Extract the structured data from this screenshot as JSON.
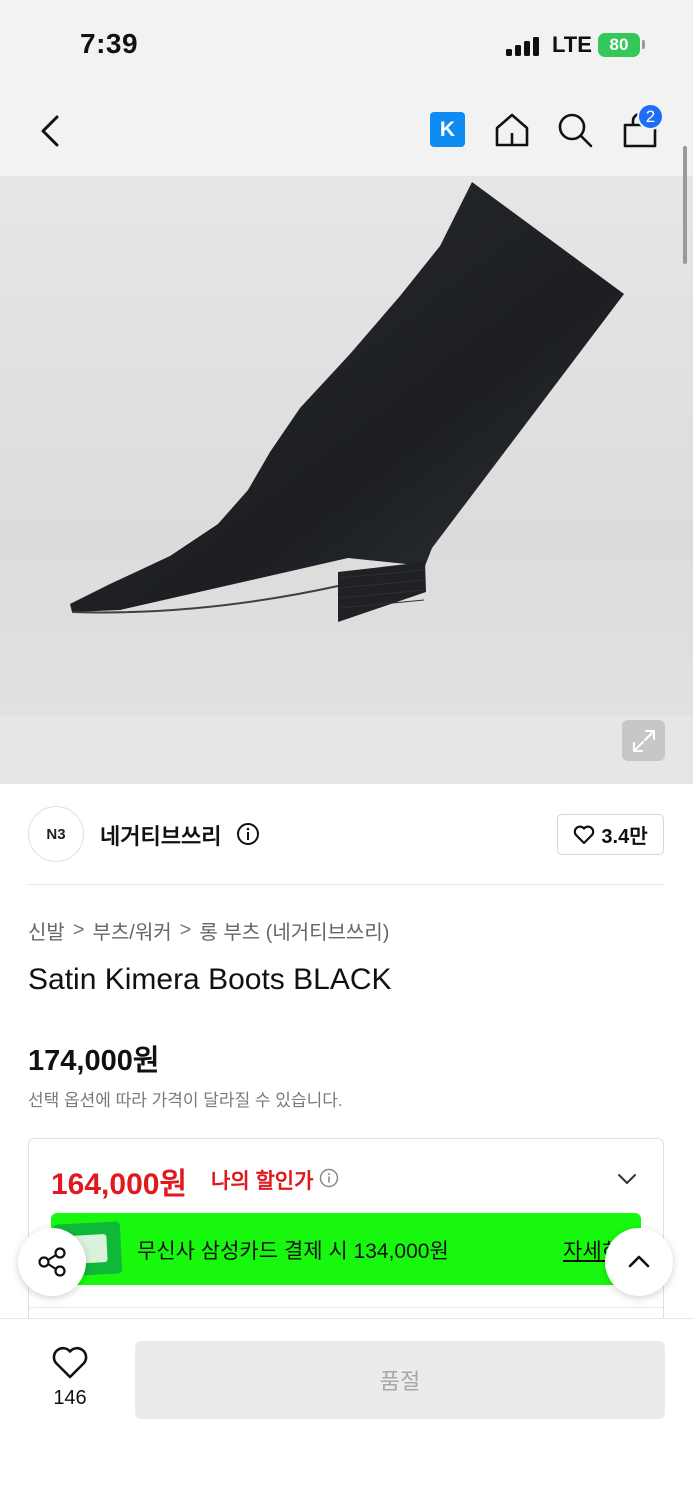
{
  "status_bar": {
    "time": "7:39",
    "network": "LTE",
    "battery": "80"
  },
  "header": {
    "kakao_label": "K",
    "cart_count": "2"
  },
  "brand": {
    "logo_text": "N3",
    "name": "네거티브쓰리",
    "likes": "3.4만"
  },
  "breadcrumb": [
    "신발",
    "부츠/워커",
    "롱 부츠 (네거티브쓰리)"
  ],
  "product": {
    "title": "Satin Kimera Boots BLACK",
    "price": "174,000원",
    "price_note": "선택 옵션에 따라 가격이 달라질 수 있습니다."
  },
  "discount": {
    "sale_price": "164,000원",
    "label": "나의 할인가",
    "card_text": "무신사 삼성카드 결제 시 134,000원",
    "detail_label": "자세히"
  },
  "bottom": {
    "like_count": "146",
    "action_label": "품절"
  },
  "colors": {
    "sale": "#e0191f",
    "banner": "#18f80f",
    "badge": "#1f6cf5",
    "kakao": "#0f8cf2"
  },
  "icons": [
    "back-arrow-icon",
    "home-icon",
    "search-icon",
    "bag-icon",
    "info-icon",
    "heart-icon",
    "expand-icon",
    "chevron-down-icon",
    "share-icon",
    "chevron-up-icon"
  ]
}
